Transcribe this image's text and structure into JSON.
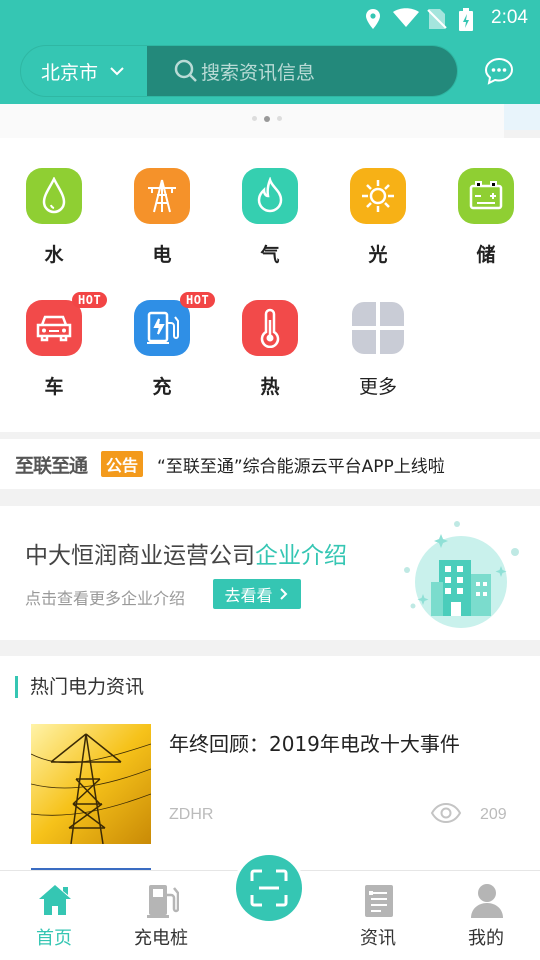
{
  "status": {
    "time": "2:04"
  },
  "header": {
    "city": "北京市",
    "search_placeholder": "搜索资讯信息"
  },
  "categories": [
    {
      "label": "水",
      "icon": "water-drop-icon",
      "color": "#8fcf33"
    },
    {
      "label": "电",
      "icon": "power-tower-icon",
      "color": "#f5922a"
    },
    {
      "label": "气",
      "icon": "flame-icon",
      "color": "#35cfb0"
    },
    {
      "label": "光",
      "icon": "sun-icon",
      "color": "#f7b116"
    },
    {
      "label": "储",
      "icon": "battery-icon",
      "color": "#8fcf33"
    },
    {
      "label": "车",
      "icon": "car-icon",
      "color": "#f24a4a",
      "badge": "HOT"
    },
    {
      "label": "充",
      "icon": "charger-icon",
      "color": "#2f8fe6",
      "badge": "HOT"
    },
    {
      "label": "热",
      "icon": "thermometer-icon",
      "color": "#f24a4a"
    },
    {
      "label": "更多",
      "icon": "more-grid-icon",
      "color": "#c9ccd6"
    }
  ],
  "notice": {
    "brand": "至联至通",
    "tag": "公告",
    "text": "“至联至通”综合能源云平台APP上线啦"
  },
  "company": {
    "name": "中大恒润商业运营公司",
    "accent": "企业介绍",
    "subtitle": "点击查看更多企业介绍",
    "button": "去看看"
  },
  "news": {
    "heading": "热门电力资讯",
    "items": [
      {
        "title": "年终回顾：2019年电改十大事件",
        "source": "ZDHR",
        "views": "209"
      }
    ]
  },
  "tabbar": {
    "home": "首页",
    "charging": "充电桩",
    "news": "资讯",
    "mine": "我的"
  },
  "colors": {
    "accent": "#35c6b3",
    "dark_accent": "#23897b"
  }
}
